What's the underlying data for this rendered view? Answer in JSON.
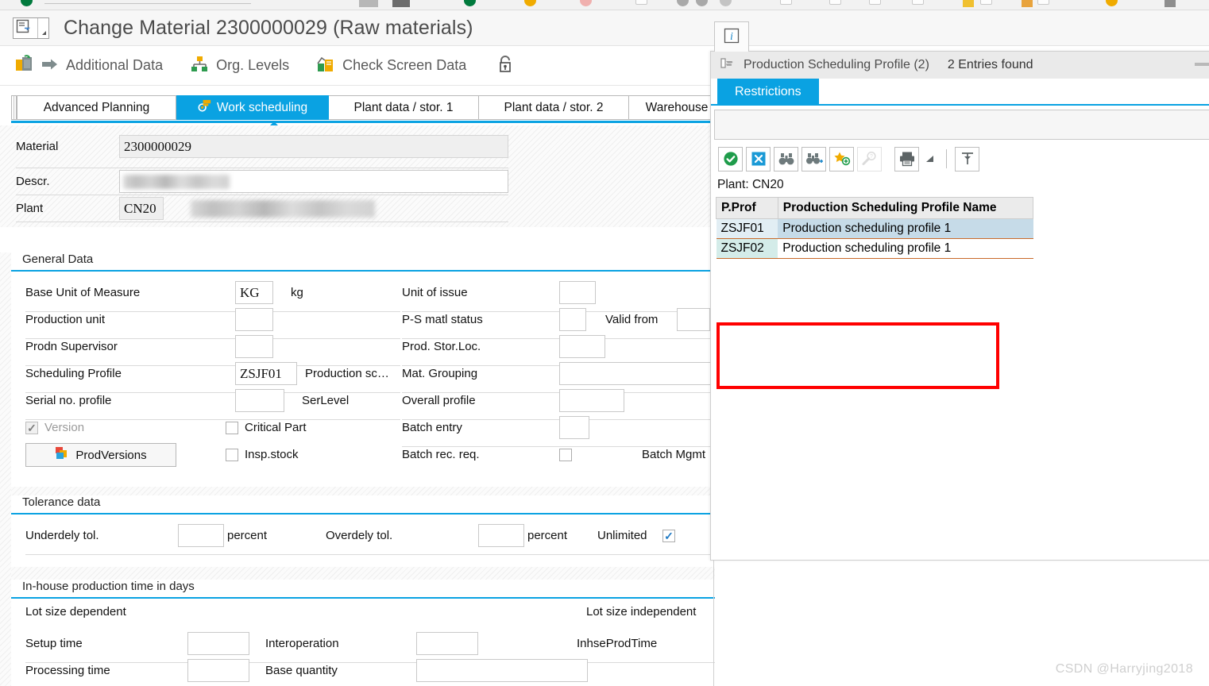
{
  "window": {
    "title": "Change Material 2300000029 (Raw materials)",
    "title_icon": "material-card-icon",
    "dropdown_icon": "chevron-down-icon"
  },
  "function_toolbar": {
    "items": [
      {
        "label": "",
        "icon": "copy-from-icon"
      },
      {
        "label": "Additional Data",
        "icon": "arrow-right-icon"
      },
      {
        "label": "Org. Levels",
        "icon": "org-levels-icon"
      },
      {
        "label": "Check Screen Data",
        "icon": "check-screen-data-icon"
      },
      {
        "label": "",
        "icon": "unlock-icon"
      }
    ]
  },
  "tabs": {
    "items": [
      {
        "label": "Advanced Planning",
        "active": false
      },
      {
        "label": "Work scheduling",
        "active": true,
        "icon": "work-scheduling-icon"
      },
      {
        "label": "Plant data / stor. 1",
        "active": false
      },
      {
        "label": "Plant data / stor. 2",
        "active": false
      },
      {
        "label": "Warehouse Mgmt...",
        "active": false
      }
    ],
    "nav_prev": "‹",
    "nav_next": "›",
    "nav_list_icon": "tab-list-icon"
  },
  "header_fields": {
    "material": {
      "label": "Material",
      "value": "2300000029"
    },
    "descr": {
      "label": "Descr.",
      "value": ""
    },
    "plant": {
      "label": "Plant",
      "value": "CN20",
      "description": ""
    }
  },
  "general_data": {
    "title": "General Data",
    "rows": [
      {
        "label": "Base Unit of Measure",
        "value": "KG",
        "suffix": "kg"
      },
      {
        "label": "Production unit",
        "value": "",
        "suffix": ""
      },
      {
        "label": "Prodn Supervisor",
        "value": "",
        "suffix": ""
      },
      {
        "label": "Scheduling Profile",
        "value": "ZSJF01",
        "suffix": "Production sc…"
      },
      {
        "label": "Serial no. profile",
        "value": "",
        "suffix": "SerLevel"
      }
    ],
    "right_rows": [
      {
        "label": "Unit of issue",
        "value": ""
      },
      {
        "label": "P-S matl status",
        "value": "",
        "extra_label": "Valid from",
        "extra_value": ""
      },
      {
        "label": "Prod. Stor.Loc.",
        "value": ""
      },
      {
        "label": "Mat. Grouping",
        "value": ""
      },
      {
        "label": "Overall profile",
        "value": ""
      },
      {
        "label": "Batch entry",
        "value": ""
      },
      {
        "label": "Batch rec. req.",
        "value": "",
        "extra_label": "Batch Mgmt"
      }
    ],
    "version_checkbox": {
      "label": "Version",
      "checked": true,
      "disabled": true
    },
    "critical_part_checkbox": {
      "label": "Critical Part",
      "checked": false
    },
    "insp_stock_checkbox": {
      "label": "Insp.stock",
      "checked": false
    },
    "prod_versions_button": {
      "label": "ProdVersions",
      "icon": "prod-versions-icon"
    }
  },
  "tolerance_data": {
    "title": "Tolerance data",
    "underdely": {
      "label": "Underdely tol.",
      "value": "",
      "unit": "percent"
    },
    "overdely": {
      "label": "Overdely tol.",
      "value": "",
      "unit": "percent"
    },
    "unlimited": {
      "label": "Unlimited",
      "checked": true
    }
  },
  "inhouse_production": {
    "title": "In-house production time in days",
    "lot_size_dependent_label": "Lot size dependent",
    "lot_size_independent_label": "Lot size independent",
    "rows": [
      {
        "label": "Setup time",
        "value": "",
        "label2": "Interoperation",
        "value2": "",
        "label3": "InhseProdTime",
        "value3": ""
      },
      {
        "label": "Processing time",
        "value": "",
        "label2": "Base quantity",
        "value2": "",
        "label3": "",
        "value3": ""
      }
    ]
  },
  "popup": {
    "info_icon": "info-icon",
    "title": "Production Scheduling Profile (2)",
    "title_icon": "hand-pointer-icon",
    "entries_found": "2 Entries found",
    "minimize_icon": "minimize-icon",
    "tab": {
      "label": "Restrictions"
    },
    "toolbar": [
      {
        "icon": "green-check-icon",
        "name": "confirm-button"
      },
      {
        "icon": "cancel-x-icon",
        "name": "cancel-button"
      },
      {
        "icon": "binoculars-icon",
        "name": "find-button"
      },
      {
        "icon": "binoculars-plus-icon",
        "name": "find-next-button"
      },
      {
        "icon": "star-plus-icon",
        "name": "personal-value-list-button"
      },
      {
        "icon": "magnifier-question-icon",
        "name": "search-help-button",
        "disabled": true
      },
      {
        "icon": "printer-icon",
        "name": "print-button"
      },
      {
        "icon": "printer-dropdown-icon",
        "name": "print-options-button"
      },
      {
        "icon": "separator",
        "name": "toolbar-separator"
      },
      {
        "icon": "filter-icon",
        "name": "filter-button"
      }
    ],
    "plant_line": "Plant: CN20",
    "table": {
      "columns": [
        "P.Prof",
        "Production Scheduling Profile Name"
      ],
      "rows": [
        {
          "cells": [
            "ZSJF01",
            "Production scheduling profile 1"
          ],
          "selected": true
        },
        {
          "cells": [
            "ZSJF02",
            "Production scheduling profile 1"
          ],
          "selected": false
        }
      ]
    },
    "highlight_color": "#ff0000"
  },
  "watermark": "CSDN @Harryjing2018",
  "colors": {
    "accent": "#0aa2e2",
    "highlight": "#ff0000",
    "row_selected": "#c6dbe8",
    "row_key_alt": "#d4ece9"
  }
}
